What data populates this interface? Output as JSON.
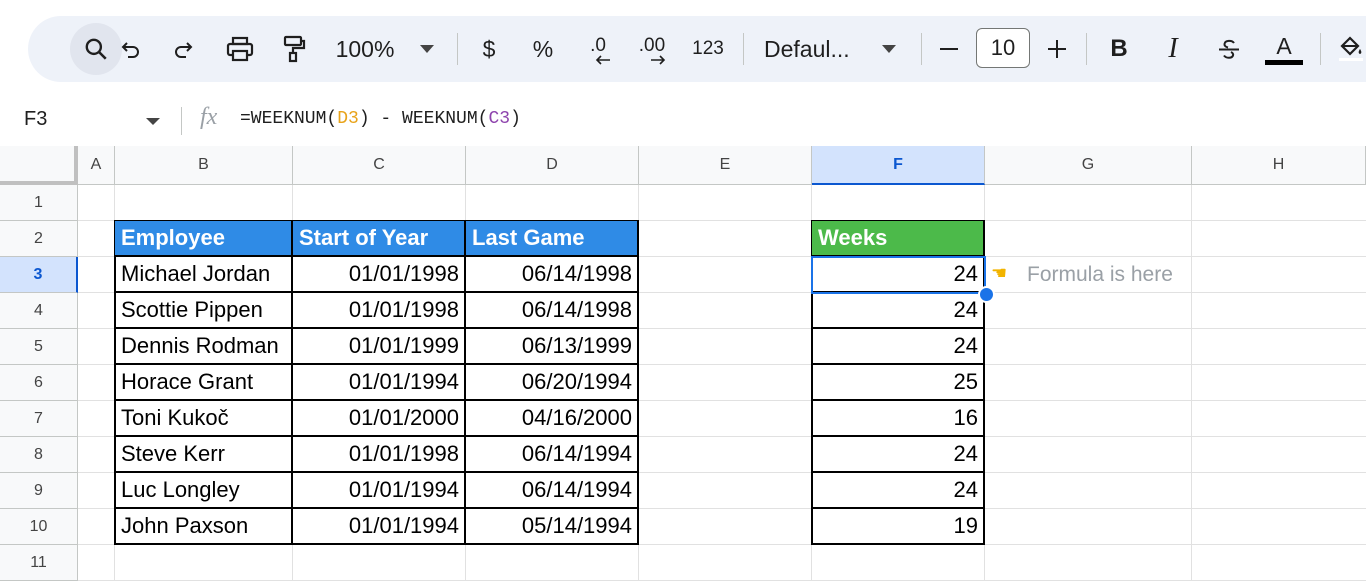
{
  "toolbar": {
    "zoom": "100%",
    "currency": "$",
    "percent": "%",
    "decrease_decimal": ".0",
    "increase_decimal": ".00",
    "number_format": "123",
    "font_name": "Defaul...",
    "font_size": "10",
    "bold": "B",
    "italic": "I",
    "text_color_letter": "A",
    "icons": [
      "search-icon",
      "undo-icon",
      "redo-icon",
      "print-icon",
      "paint-format-icon",
      "zoom-dropdown-icon",
      "font-dropdown-icon",
      "minus-icon",
      "plus-icon",
      "strikethrough-icon",
      "fill-color-icon"
    ]
  },
  "formula_bar": {
    "name_box": "F3",
    "fx": "fx",
    "formula_prefix": "=WEEKNUM(",
    "ref1": "D3",
    "formula_mid": ") - WEEKNUM(",
    "ref2": "C3",
    "formula_suffix": ")"
  },
  "columns": [
    "A",
    "B",
    "C",
    "D",
    "E",
    "F",
    "G",
    "H"
  ],
  "rows": [
    "1",
    "2",
    "3",
    "4",
    "5",
    "6",
    "7",
    "8",
    "9",
    "10",
    "11"
  ],
  "selected_cell": {
    "column": "F",
    "row": "3"
  },
  "table": {
    "headers": [
      "Employee",
      "Start of Year",
      "Last Game"
    ],
    "rows": [
      [
        "Michael Jordan",
        "01/01/1998",
        "06/14/1998"
      ],
      [
        "Scottie Pippen",
        "01/01/1998",
        "06/14/1998"
      ],
      [
        "Dennis Rodman",
        "01/01/1999",
        "06/13/1999"
      ],
      [
        "Horace Grant",
        "01/01/1994",
        "06/20/1994"
      ],
      [
        "Toni Kukoč",
        "01/01/2000",
        "04/16/2000"
      ],
      [
        "Steve Kerr",
        "01/01/1998",
        "06/14/1994"
      ],
      [
        "Luc Longley",
        "01/01/1994",
        "06/14/1994"
      ],
      [
        "John Paxson",
        "01/01/1994",
        "05/14/1994"
      ]
    ]
  },
  "weeks": {
    "header": "Weeks",
    "values": [
      "24",
      "24",
      "24",
      "25",
      "16",
      "24",
      "24",
      "19"
    ]
  },
  "note": {
    "icon": "pointing-hand-icon",
    "text": "Formula is here"
  },
  "colors": {
    "header_blue": "#2f8be6",
    "header_green": "#4cba4a",
    "selection": "#1a73e8"
  }
}
